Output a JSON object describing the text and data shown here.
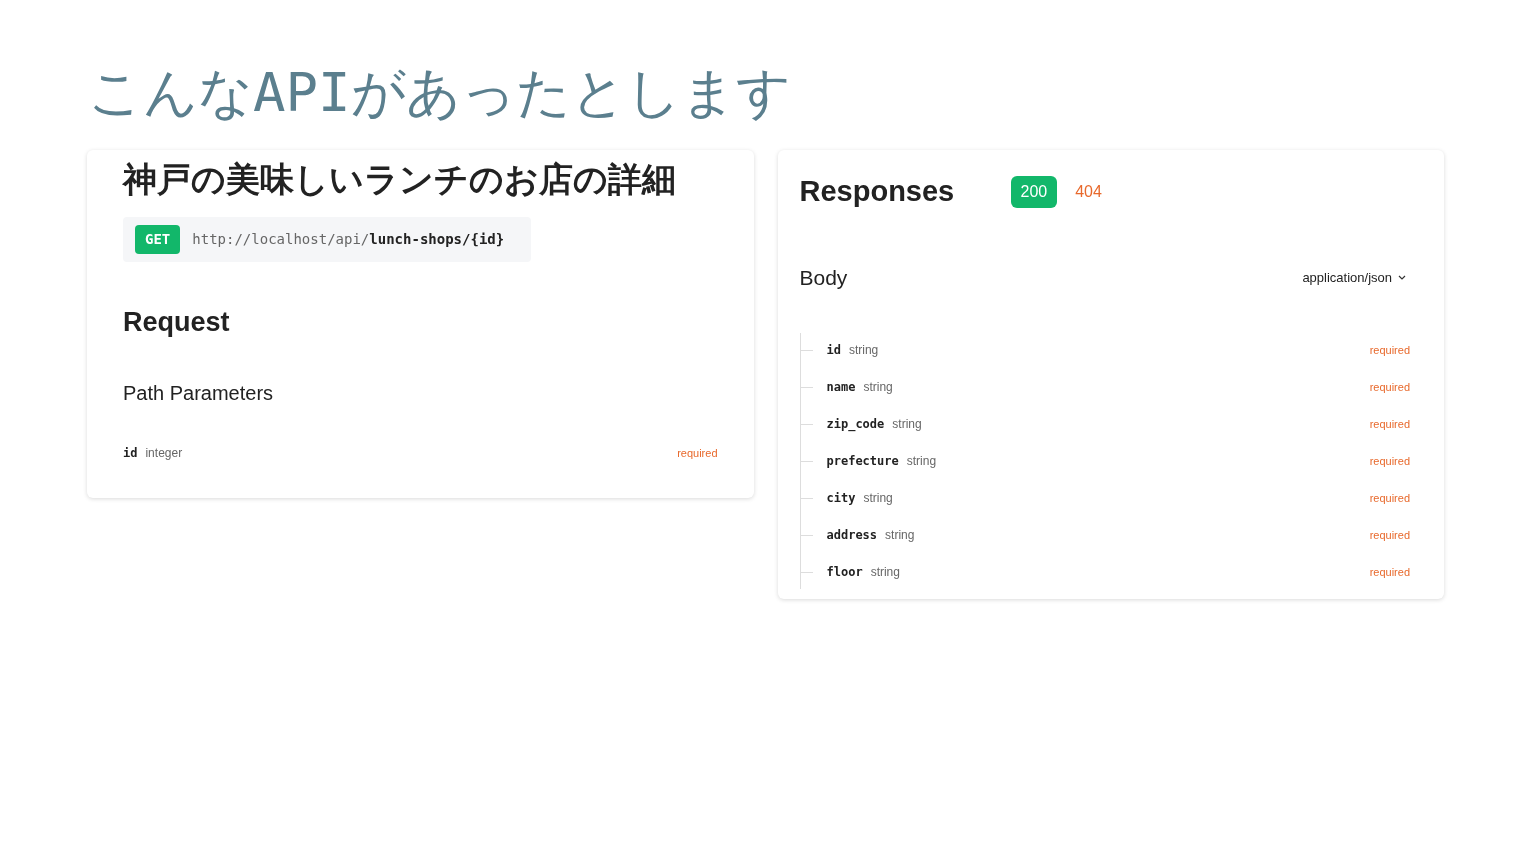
{
  "slide_title": "こんなAPIがあったとします",
  "endpoint": {
    "title": "神戸の美味しいランチのお店の詳細",
    "method": "GET",
    "url": "http://localhost/api/**lunch-shops/{id}**",
    "request": {
      "heading": "Request",
      "section": "Path Parameters",
      "params": [
        {
          "name": "id",
          "type": "integer",
          "flag": "required"
        }
      ]
    }
  },
  "responses": {
    "heading": "Responses",
    "codes": [
      {
        "label": "200",
        "selected": true,
        "color": "#12b76a"
      },
      {
        "label": "404",
        "selected": false,
        "color": "#e8692c"
      }
    ],
    "body_heading": "Body",
    "content_type": "application/json",
    "fields": [
      {
        "name": "id",
        "type": "string",
        "flag": "required"
      },
      {
        "name": "name",
        "type": "string",
        "flag": "required"
      },
      {
        "name": "zip_code",
        "type": "string",
        "flag": "required"
      },
      {
        "name": "prefecture",
        "type": "string",
        "flag": "required"
      },
      {
        "name": "city",
        "type": "string",
        "flag": "required"
      },
      {
        "name": "address",
        "type": "string",
        "flag": "required"
      },
      {
        "name": "floor",
        "type": "string",
        "flag": "required"
      }
    ]
  }
}
